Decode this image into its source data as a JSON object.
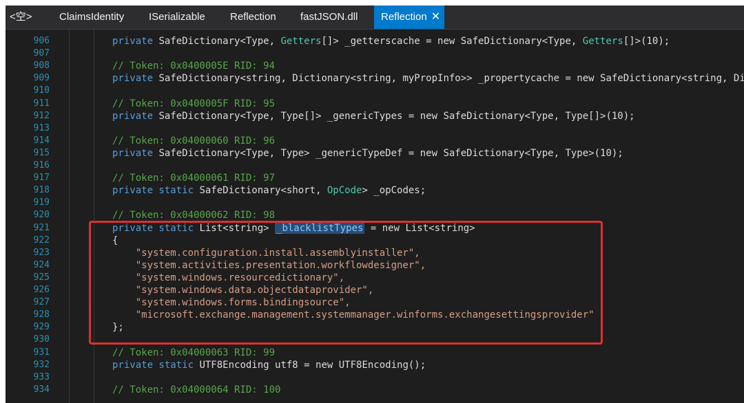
{
  "tabs": [
    {
      "label": "<空>"
    },
    {
      "label": "ClaimsIdentity"
    },
    {
      "label": "ISerializable"
    },
    {
      "label": "Reflection"
    },
    {
      "label": "fastJSON.dll"
    },
    {
      "label": "Reflection",
      "close": "✕"
    }
  ],
  "code": {
    "lines": [
      {
        "n": "906",
        "segs": [
          {
            "c": "kw",
            "t": "private "
          },
          {
            "c": "plain",
            "t": "SafeDictionary<Type, "
          },
          {
            "c": "type",
            "t": "Getters"
          },
          {
            "c": "plain",
            "t": "[]> _getterscache = new SafeDictionary<Type, "
          },
          {
            "c": "type",
            "t": "Getters"
          },
          {
            "c": "plain",
            "t": "[]>(10);"
          }
        ]
      },
      {
        "n": "907",
        "segs": []
      },
      {
        "n": "908",
        "segs": [
          {
            "c": "comment",
            "t": "// Token: 0x0400005E RID: 94"
          }
        ]
      },
      {
        "n": "909",
        "segs": [
          {
            "c": "kw",
            "t": "private "
          },
          {
            "c": "plain",
            "t": "SafeDictionary<string, Dictionary<string, myPropInfo>> _propertycache = new SafeDictionary<string, Di"
          }
        ]
      },
      {
        "n": "910",
        "segs": []
      },
      {
        "n": "911",
        "segs": [
          {
            "c": "comment",
            "t": "// Token: 0x0400005F RID: 95"
          }
        ]
      },
      {
        "n": "912",
        "segs": [
          {
            "c": "kw",
            "t": "private "
          },
          {
            "c": "plain",
            "t": "SafeDictionary<Type, Type[]> _genericTypes = new SafeDictionary<Type, Type[]>(10);"
          }
        ]
      },
      {
        "n": "913",
        "segs": []
      },
      {
        "n": "914",
        "segs": [
          {
            "c": "comment",
            "t": "// Token: 0x04000060 RID: 96"
          }
        ]
      },
      {
        "n": "915",
        "segs": [
          {
            "c": "kw",
            "t": "private "
          },
          {
            "c": "plain",
            "t": "SafeDictionary<Type, Type> _genericTypeDef = new SafeDictionary<Type, Type>(10);"
          }
        ]
      },
      {
        "n": "916",
        "segs": []
      },
      {
        "n": "917",
        "segs": [
          {
            "c": "comment",
            "t": "// Token: 0x04000061 RID: 97"
          }
        ]
      },
      {
        "n": "918",
        "segs": [
          {
            "c": "kw",
            "t": "private static "
          },
          {
            "c": "plain",
            "t": "SafeDictionary<short, "
          },
          {
            "c": "type",
            "t": "OpCode"
          },
          {
            "c": "plain",
            "t": "> _opCodes;"
          }
        ]
      },
      {
        "n": "919",
        "segs": []
      },
      {
        "n": "920",
        "segs": [
          {
            "c": "comment",
            "t": "// Token: 0x04000062 RID: 98"
          }
        ]
      },
      {
        "n": "921",
        "segs": [
          {
            "c": "kw",
            "t": "private static "
          },
          {
            "c": "plain",
            "t": "List<string> "
          },
          {
            "c": "hl",
            "t": "_blacklistTypes"
          },
          {
            "c": "plain",
            "t": " = new List<string>"
          }
        ]
      },
      {
        "n": "922",
        "segs": [
          {
            "c": "plain",
            "t": "{"
          }
        ]
      },
      {
        "n": "923",
        "segs": [
          {
            "c": "str",
            "t": "    \"system.configuration.install.assemblyinstaller\","
          }
        ]
      },
      {
        "n": "924",
        "segs": [
          {
            "c": "str",
            "t": "    \"system.activities.presentation.workflowdesigner\","
          }
        ]
      },
      {
        "n": "925",
        "segs": [
          {
            "c": "str",
            "t": "    \"system.windows.resourcedictionary\","
          }
        ]
      },
      {
        "n": "926",
        "segs": [
          {
            "c": "str",
            "t": "    \"system.windows.data.objectdataprovider\","
          }
        ]
      },
      {
        "n": "927",
        "segs": [
          {
            "c": "str",
            "t": "    \"system.windows.forms.bindingsource\","
          }
        ]
      },
      {
        "n": "928",
        "segs": [
          {
            "c": "str",
            "t": "    \"microsoft.exchange.management.systemmanager.winforms.exchangesettingsprovider\""
          }
        ]
      },
      {
        "n": "929",
        "segs": [
          {
            "c": "plain",
            "t": "};"
          }
        ]
      },
      {
        "n": "930",
        "segs": []
      },
      {
        "n": "931",
        "segs": [
          {
            "c": "comment",
            "t": "// Token: 0x04000063 RID: 99"
          }
        ]
      },
      {
        "n": "932",
        "segs": [
          {
            "c": "kw",
            "t": "private static "
          },
          {
            "c": "plain",
            "t": "UTF8Encoding utf8 = new UTF8Encoding();"
          }
        ]
      },
      {
        "n": "933",
        "segs": []
      },
      {
        "n": "934",
        "segs": [
          {
            "c": "comment",
            "t": "// Token: 0x04000064 RID: 100"
          }
        ]
      }
    ]
  },
  "colors": {
    "accent": "#007acc",
    "highlight_box": "#e03030"
  }
}
